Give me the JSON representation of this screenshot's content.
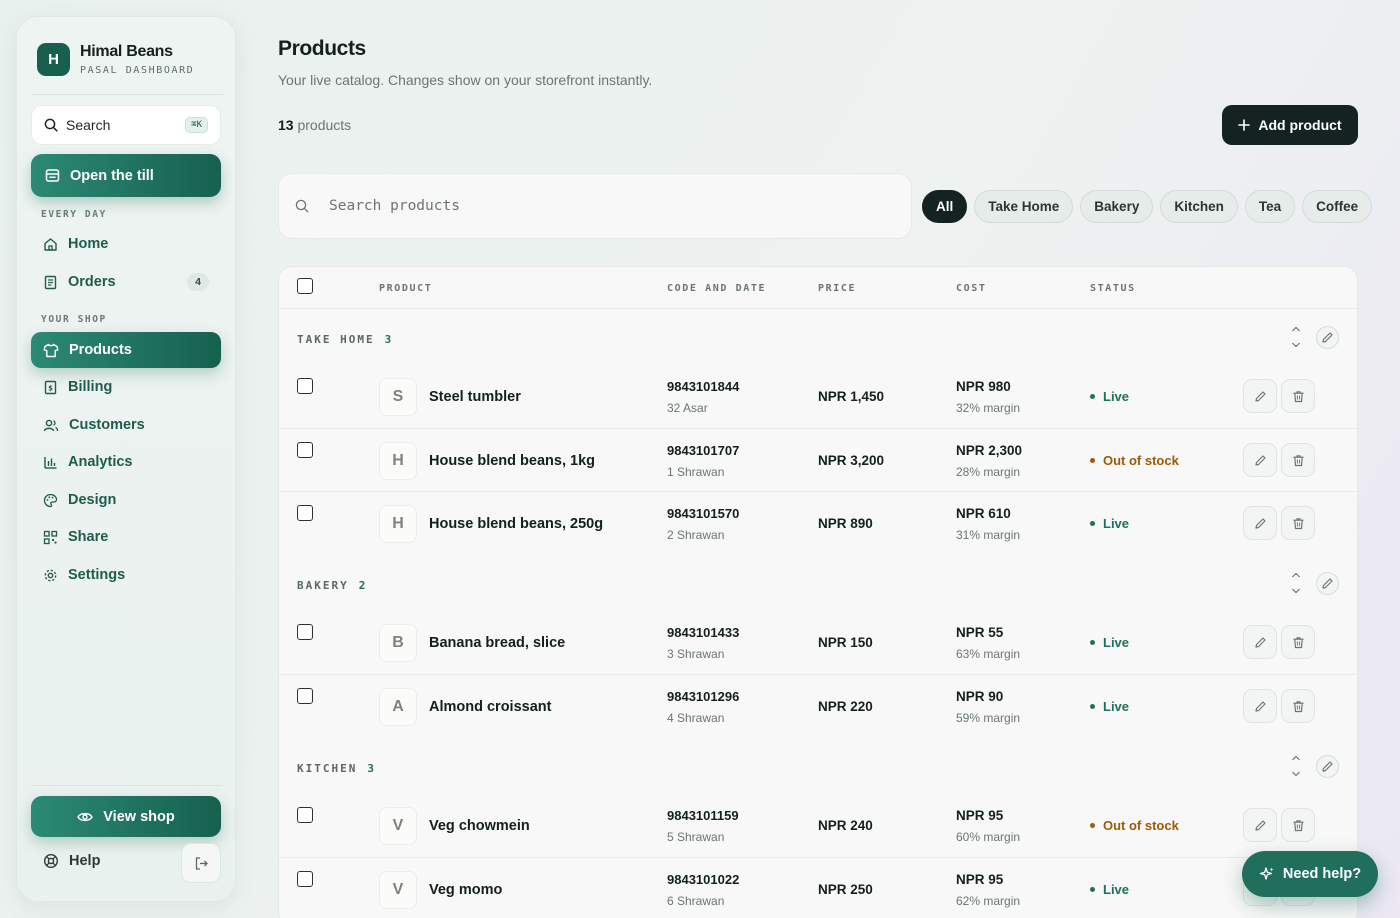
{
  "brand": {
    "initial": "H",
    "name": "Himal Beans",
    "subtitle": "PASAL DASHBOARD"
  },
  "sidebar": {
    "search_label": "Search",
    "search_shortcut": "⌘K",
    "till_label": "Open the till",
    "sections": [
      {
        "label": "EVERY DAY",
        "items": [
          {
            "label": "Home",
            "icon": "home-icon"
          },
          {
            "label": "Orders",
            "icon": "receipt-icon",
            "badge": "4"
          }
        ]
      },
      {
        "label": "YOUR SHOP",
        "items": [
          {
            "label": "Products",
            "icon": "shirt-icon",
            "active": true
          },
          {
            "label": "Billing",
            "icon": "billing-icon"
          },
          {
            "label": "Customers",
            "icon": "users-icon"
          },
          {
            "label": "Analytics",
            "icon": "chart-icon"
          },
          {
            "label": "Design",
            "icon": "palette-icon"
          },
          {
            "label": "Share",
            "icon": "qr-icon"
          },
          {
            "label": "Settings",
            "icon": "gear-icon"
          }
        ]
      }
    ],
    "view_shop_label": "View shop",
    "help_label": "Help"
  },
  "main": {
    "title": "Products",
    "subtitle": "Your live catalog. Changes show on your storefront instantly.",
    "count_number": "13",
    "count_label": " products",
    "add_label": "Add product",
    "search_placeholder": "Search products",
    "filters": [
      "All",
      "Take Home",
      "Bakery",
      "Kitchen",
      "Tea",
      "Coffee"
    ],
    "active_filter": "All"
  },
  "table": {
    "columns": [
      "PRODUCT",
      "CODE AND DATE",
      "PRICE",
      "COST",
      "STATUS"
    ],
    "groups": [
      {
        "title": "TAKE HOME",
        "count": "3",
        "rows": [
          {
            "initial": "S",
            "name": "Steel tumbler",
            "code": "9843101844",
            "date": "32 Asar",
            "price": "NPR 1,450",
            "cost": "NPR 980",
            "margin": "32% margin",
            "status": "Live"
          },
          {
            "initial": "H",
            "name": "House blend beans, 1kg",
            "code": "9843101707",
            "date": "1 Shrawan",
            "price": "NPR 3,200",
            "cost": "NPR 2,300",
            "margin": "28% margin",
            "status": "Out of stock"
          },
          {
            "initial": "H",
            "name": "House blend beans, 250g",
            "code": "9843101570",
            "date": "2 Shrawan",
            "price": "NPR 890",
            "cost": "NPR 610",
            "margin": "31% margin",
            "status": "Live"
          }
        ]
      },
      {
        "title": "BAKERY",
        "count": "2",
        "rows": [
          {
            "initial": "B",
            "name": "Banana bread, slice",
            "code": "9843101433",
            "date": "3 Shrawan",
            "price": "NPR 150",
            "cost": "NPR 55",
            "margin": "63% margin",
            "status": "Live"
          },
          {
            "initial": "A",
            "name": "Almond croissant",
            "code": "9843101296",
            "date": "4 Shrawan",
            "price": "NPR 220",
            "cost": "NPR 90",
            "margin": "59% margin",
            "status": "Live"
          }
        ]
      },
      {
        "title": "KITCHEN",
        "count": "3",
        "rows": [
          {
            "initial": "V",
            "name": "Veg chowmein",
            "code": "9843101159",
            "date": "5 Shrawan",
            "price": "NPR 240",
            "cost": "NPR 95",
            "margin": "60% margin",
            "status": "Out of stock"
          },
          {
            "initial": "V",
            "name": "Veg momo",
            "code": "9843101022",
            "date": "6 Shrawan",
            "price": "NPR 250",
            "cost": "NPR 95",
            "margin": "62% margin",
            "status": "Live"
          }
        ]
      }
    ]
  },
  "need_help_label": "Need help?",
  "colors": {
    "accent": "#17604f",
    "live": "#1f6f5c",
    "out_of_stock": "#9c5b06",
    "dark": "#152320"
  }
}
